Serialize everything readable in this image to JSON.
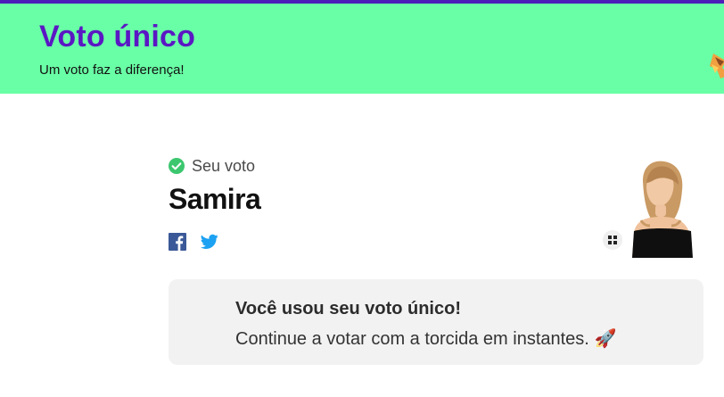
{
  "header": {
    "title": "Voto único",
    "subtitle": "Um voto faz a diferença!",
    "background_color": "#69ffa6",
    "title_color": "#5b17c4",
    "top_bar_color": "#4b1fb8"
  },
  "vote": {
    "status_label": "Seu voto",
    "status_icon": "check-circle-icon",
    "status_color": "#3cc76f",
    "candidate_name": "Samira",
    "share": [
      {
        "name": "facebook-icon",
        "color": "#3b5998"
      },
      {
        "name": "twitter-icon",
        "color": "#1da1f2"
      }
    ]
  },
  "notice": {
    "title": "Você usou seu voto único!",
    "body": "Continue a votar com a torcida em instantes.",
    "emoji": "🚀"
  }
}
